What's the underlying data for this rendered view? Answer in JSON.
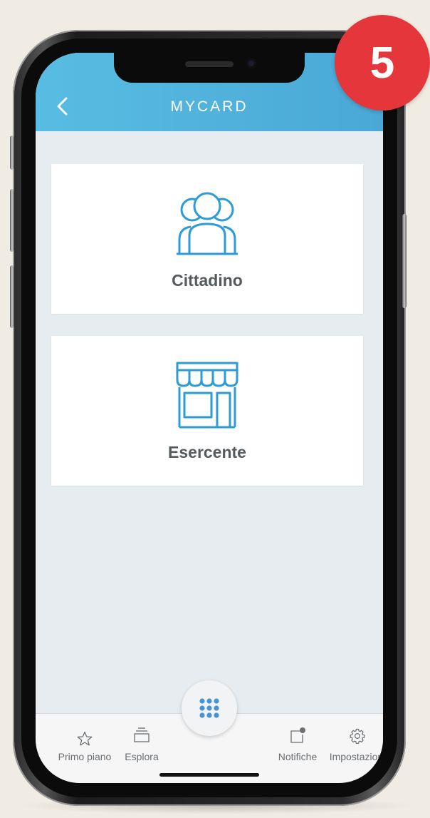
{
  "header": {
    "title": "MYCARD"
  },
  "cards": [
    {
      "label": "Cittadino",
      "icon": "people-group-icon"
    },
    {
      "label": "Esercente",
      "icon": "storefront-icon"
    }
  ],
  "tabbar": {
    "items": [
      {
        "label": "Primo piano",
        "icon": "star-icon"
      },
      {
        "label": "Esplora",
        "icon": "layers-icon"
      },
      {
        "label": "Notifiche",
        "icon": "notification-icon"
      },
      {
        "label": "Impostazioni",
        "icon": "gear-icon"
      }
    ],
    "center_icon": "grid-dots-icon"
  },
  "badge": {
    "step": "5",
    "color": "#e4363b"
  },
  "colors": {
    "accent": "#4ab2dd",
    "icon_stroke": "#2d9bd7",
    "card_text": "#555a5e"
  }
}
